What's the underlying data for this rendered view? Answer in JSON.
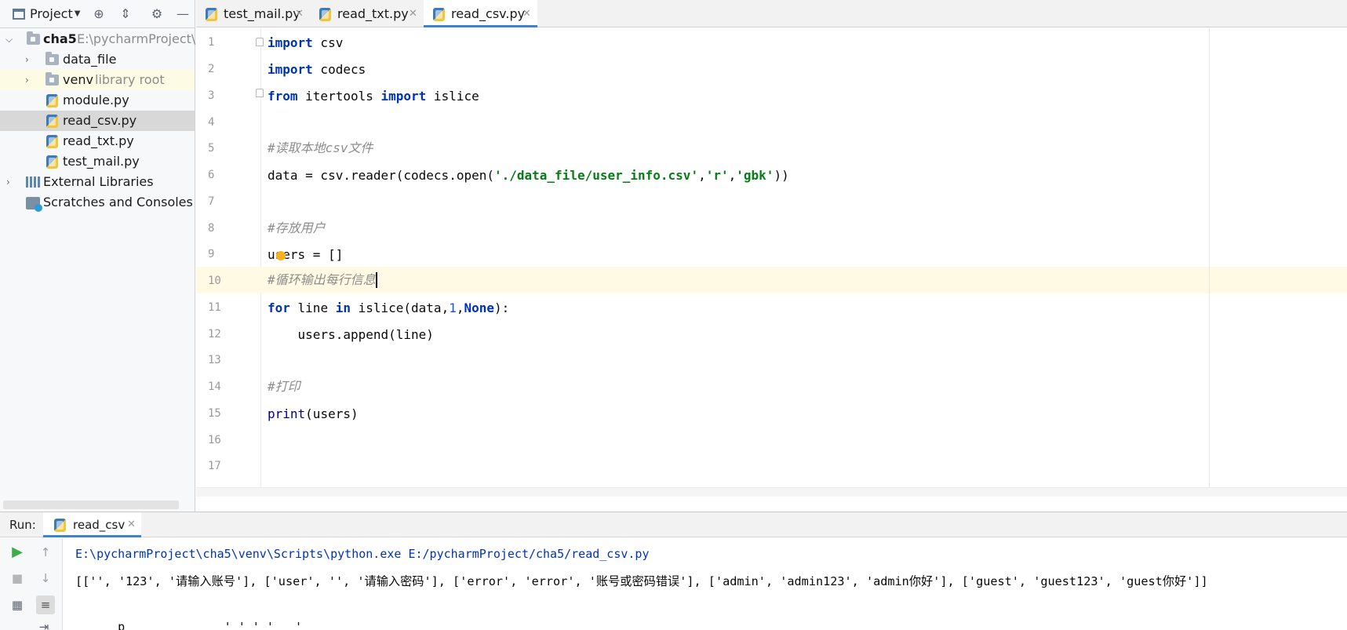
{
  "project_panel": {
    "title": "Project",
    "tree": [
      {
        "name": "cha5",
        "hint": "E:\\pycharmProject\\ch",
        "type": "root"
      },
      {
        "name": "data_file",
        "hint": "",
        "type": "folder"
      },
      {
        "name": "venv",
        "hint": "library root",
        "type": "folder"
      },
      {
        "name": "module.py",
        "hint": "",
        "type": "file"
      },
      {
        "name": "read_csv.py",
        "hint": "",
        "type": "file"
      },
      {
        "name": "read_txt.py",
        "hint": "",
        "type": "file"
      },
      {
        "name": "test_mail.py",
        "hint": "",
        "type": "file"
      },
      {
        "name": "External Libraries",
        "hint": "",
        "type": "libraries"
      },
      {
        "name": "Scratches and Consoles",
        "hint": "",
        "type": "scratches"
      }
    ],
    "selected": "read_csv.py"
  },
  "editor": {
    "tabs": [
      {
        "label": "test_mail.py",
        "active": false
      },
      {
        "label": "read_txt.py",
        "active": false
      },
      {
        "label": "read_csv.py",
        "active": true
      }
    ],
    "line_numbers": [
      "1",
      "2",
      "3",
      "4",
      "5",
      "6",
      "7",
      "8",
      "9",
      "10",
      "11",
      "12",
      "13",
      "14",
      "15",
      "16",
      "17"
    ],
    "current_line": "10",
    "code": {
      "l1_kw": "import",
      "l1_rest": " csv",
      "l2_kw": "import",
      "l2_rest": " codecs",
      "l3_kw1": "from",
      "l3_mid": " itertools ",
      "l3_kw2": "import",
      "l3_rest": " islice",
      "l5_comment": "#读取本地csv文件",
      "l6_a": "data = csv.reader(codecs.open(",
      "l6_s1": "'./data_file/user_info.csv'",
      "l6_c1": ",",
      "l6_s2": "'r'",
      "l6_c2": ",",
      "l6_s3": "'gbk'",
      "l6_end": "))",
      "l8_comment": "#存放用户",
      "l9": "users = []",
      "l10_comment": "#循环输出每行信息",
      "l11_kw1": "for",
      "l11_mid1": " line ",
      "l11_kw2": "in",
      "l11_mid2": " islice(data,",
      "l11_num": "1",
      "l11_c": ",",
      "l11_kw3": "None",
      "l11_end": "):",
      "l12": "    users.append(line)",
      "l14_comment": "#打印",
      "l15_builtin": "print",
      "l15_rest": "(users)"
    }
  },
  "run_panel": {
    "label": "Run:",
    "tab_label": "read_csv",
    "command": "E:\\pycharmProject\\cha5\\venv\\Scripts\\python.exe E:/pycharmProject/cha5/read_csv.py",
    "output": "[['', '123', '请输入账号'], ['user', '', '请输入密码'], ['error', 'error', '账号或密码错误'], ['admin', 'admin123', 'admin你好'], ['guest', 'guest123', 'guest你好']]",
    "partial": "      p              ' ' ' '   '"
  },
  "colors": {
    "keyword": "#0033b3",
    "string": "#067d17",
    "comment": "#8c8c8c",
    "number": "#1750eb",
    "selection": "#d8d8d8",
    "tab_accent": "#4083c9",
    "current_line": "#fffae3"
  },
  "icons": [
    "project-view-icon",
    "locate-icon",
    "collapse-icon",
    "gear-icon",
    "minimize-icon",
    "folder-icon",
    "python-file-icon",
    "libraries-icon",
    "scratches-icon",
    "run-icon",
    "stop-icon",
    "up-arrow-icon",
    "down-arrow-icon",
    "soft-wrap-icon",
    "layout-icon",
    "intention-bulb-icon"
  ]
}
